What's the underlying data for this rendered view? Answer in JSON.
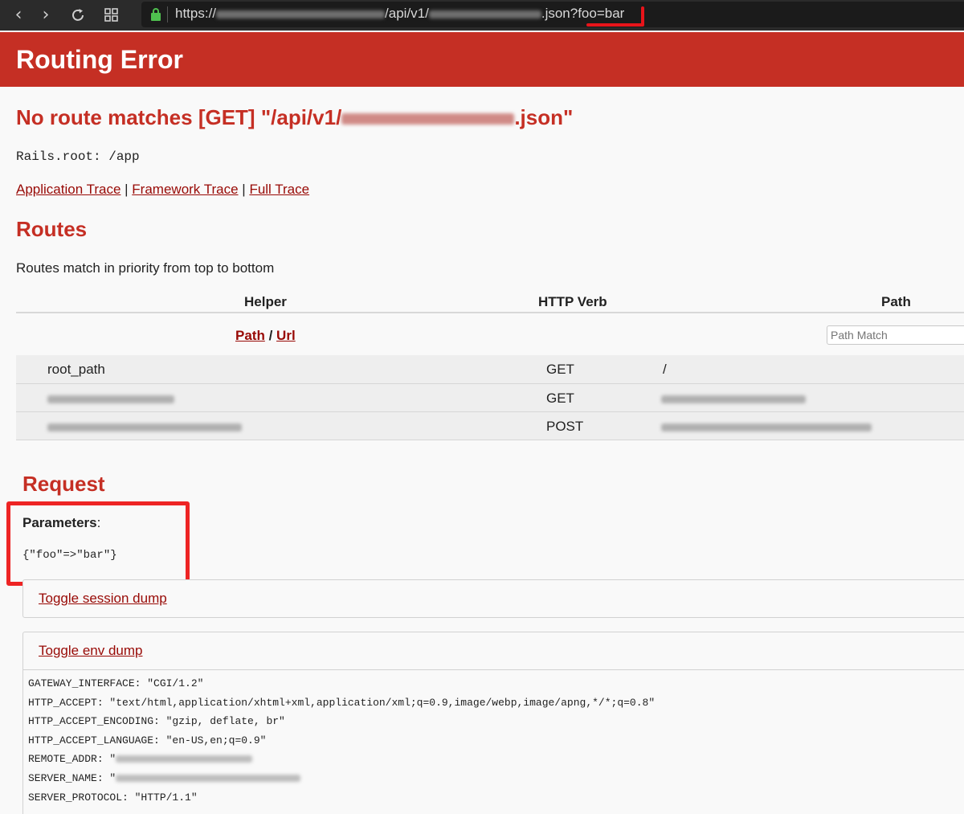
{
  "browser": {
    "back_icon": "chevron-left-icon",
    "forward_icon": "chevron-right-icon",
    "reload_icon": "reload-icon",
    "tabs_icon": "grid-icon",
    "url_prefix": "https://",
    "url_middle": "/api/v1/",
    "url_suffix": ".json?foo=bar",
    "accent": "#e8141a"
  },
  "header": {
    "title": "Routing Error",
    "color": "#c52f24"
  },
  "error": {
    "prefix": "No route matches [GET] \"/api/v1/",
    "suffix": ".json\""
  },
  "rails_root": "Rails.root: /app",
  "traces": {
    "application": "Application Trace",
    "framework": "Framework Trace",
    "full": "Full Trace",
    "sep": "|"
  },
  "routes": {
    "title": "Routes",
    "subtitle": "Routes match in priority from top to bottom",
    "headers": {
      "helper": "Helper",
      "verb": "HTTP Verb",
      "path": "Path"
    },
    "path_link": "Path",
    "slash": "/",
    "url_link": "Url",
    "path_match_placeholder": "Path Match",
    "rows": [
      {
        "helper": "root_path",
        "verb": "GET",
        "path": "/"
      },
      {
        "helper": "",
        "verb": "GET",
        "path": ""
      },
      {
        "helper": "",
        "verb": "POST",
        "path": ""
      }
    ]
  },
  "request": {
    "title": "Request",
    "params_label": "Parameters",
    "params_colon": ":",
    "params_value": "{\"foo\"=>\"bar\"}",
    "toggle_session": "Toggle session dump",
    "toggle_env": "Toggle env dump"
  },
  "env": [
    "GATEWAY_INTERFACE: \"CGI/1.2\"",
    "HTTP_ACCEPT: \"text/html,application/xhtml+xml,application/xml;q=0.9,image/webp,image/apng,*/*;q=0.8\"",
    "HTTP_ACCEPT_ENCODING: \"gzip, deflate, br\"",
    "HTTP_ACCEPT_LANGUAGE: \"en-US,en;q=0.9\"",
    "REMOTE_ADDR: \"",
    "SERVER_NAME: \"",
    "SERVER_PROTOCOL: \"HTTP/1.1\""
  ]
}
